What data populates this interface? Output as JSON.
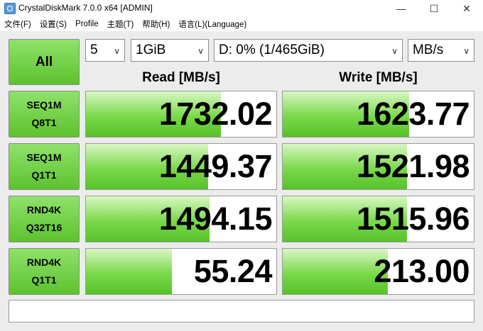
{
  "window": {
    "title": "CrystalDiskMark 7.0.0 x64 [ADMIN]",
    "minimize_glyph": "—",
    "maximize_glyph": "☐",
    "close_glyph": "✕"
  },
  "menu": [
    "文件(F)",
    "设置(S)",
    "Profile",
    "主题(T)",
    "帮助(H)",
    "语言(L)(Language)"
  ],
  "controls": {
    "all_label": "All",
    "count": "5",
    "size": "1GiB",
    "drive": "D: 0% (1/465GiB)",
    "unit": "MB/s"
  },
  "headers": {
    "read": "Read [MB/s]",
    "write": "Write [MB/s]"
  },
  "tests": [
    {
      "line1": "SEQ1M",
      "line2": "Q8T1",
      "read": "1732.02",
      "write": "1623.77",
      "read_fill": 0.71,
      "write_fill": 0.66
    },
    {
      "line1": "SEQ1M",
      "line2": "Q1T1",
      "read": "1449.37",
      "write": "1521.98",
      "read_fill": 0.64,
      "write_fill": 0.65
    },
    {
      "line1": "RND4K",
      "line2": "Q32T16",
      "read": "1494.15",
      "write": "1515.96",
      "read_fill": 0.65,
      "write_fill": 0.65
    },
    {
      "line1": "RND4K",
      "line2": "Q1T1",
      "read": "55.24",
      "write": "213.00",
      "read_fill": 0.45,
      "write_fill": 0.55
    }
  ],
  "comment": ""
}
